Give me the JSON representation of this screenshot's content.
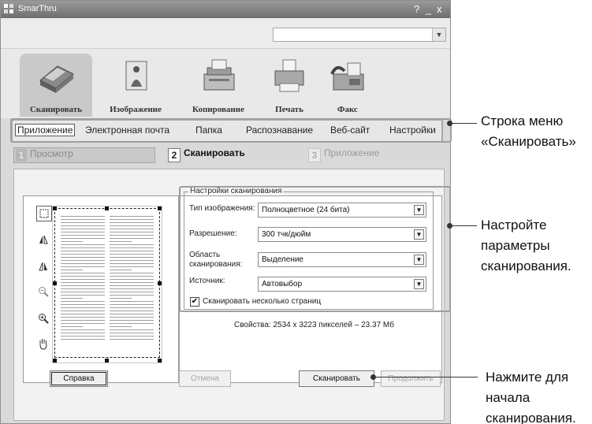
{
  "window": {
    "title": "SmarThru",
    "help_glyph": "?",
    "minimize_glyph": "_",
    "close_glyph": "x"
  },
  "toolbar": {
    "items": [
      {
        "label": "Сканировать",
        "icon": "scanner-icon",
        "active": true
      },
      {
        "label": "Изображение",
        "icon": "image-icon",
        "active": false
      },
      {
        "label": "Копирование",
        "icon": "copier-icon",
        "active": false
      },
      {
        "label": "Печать",
        "icon": "printer-icon",
        "active": false
      },
      {
        "label": "Факс",
        "icon": "fax-icon",
        "active": false
      }
    ]
  },
  "menu": {
    "items": [
      "Приложение",
      "Электронная почта",
      "Папка",
      "Распознавание",
      "Веб-сайт",
      "Настройки"
    ],
    "active_index": 0
  },
  "steps": [
    {
      "number": "1",
      "label": "Просмотр"
    },
    {
      "number": "2",
      "label": "Сканировать"
    },
    {
      "number": "3",
      "label": "Приложение"
    }
  ],
  "settings": {
    "group_title": "Настройки сканирования",
    "image_type_label": "Тип изображения:",
    "image_type_value": "Полноцветное (24 бита)",
    "resolution_label": "Разрешение:",
    "resolution_value": "300 тчк/дюйм",
    "area_label": "Область сканирования:",
    "area_value": "Выделение",
    "source_label": "Источник:",
    "source_value": "Автовыбор",
    "multi_page_label": "Сканировать несколько страниц",
    "multi_page_checked": true
  },
  "properties_text": "Свойства: 2534 x 3223 пикселей – 23.37 Мб",
  "buttons": {
    "help": "Справка",
    "cancel": "Отмена",
    "scan": "Сканировать",
    "next": "Продолжить"
  },
  "callouts": {
    "menu": [
      "Строка меню",
      "«Сканировать»"
    ],
    "settings": [
      "Настройте",
      "параметры",
      "сканирования."
    ],
    "scan": [
      "Нажмите для",
      "начала",
      "сканирования."
    ]
  }
}
